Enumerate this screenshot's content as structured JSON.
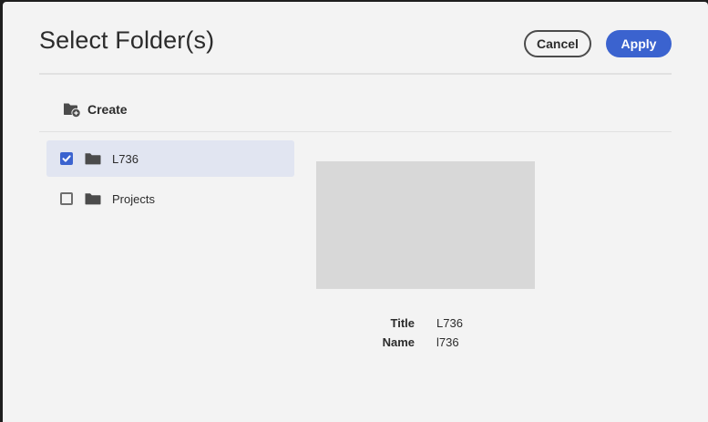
{
  "dialog": {
    "title": "Select Folder(s)",
    "cancel_label": "Cancel",
    "apply_label": "Apply"
  },
  "toolbar": {
    "create_label": "Create",
    "create_icon": "folder-add-icon"
  },
  "folders": [
    {
      "label": "L736",
      "checked": true,
      "icon": "folder-icon"
    },
    {
      "label": "Projects",
      "checked": false,
      "icon": "folder-icon"
    }
  ],
  "details": {
    "title_key": "Title",
    "title_value": "L736",
    "name_key": "Name",
    "name_value": "l736"
  },
  "colors": {
    "accent": "#3b63cf",
    "selected_row": "#e1e5f1",
    "dialog_bg": "#f3f3f3",
    "preview_bg": "#d8d8d8"
  }
}
